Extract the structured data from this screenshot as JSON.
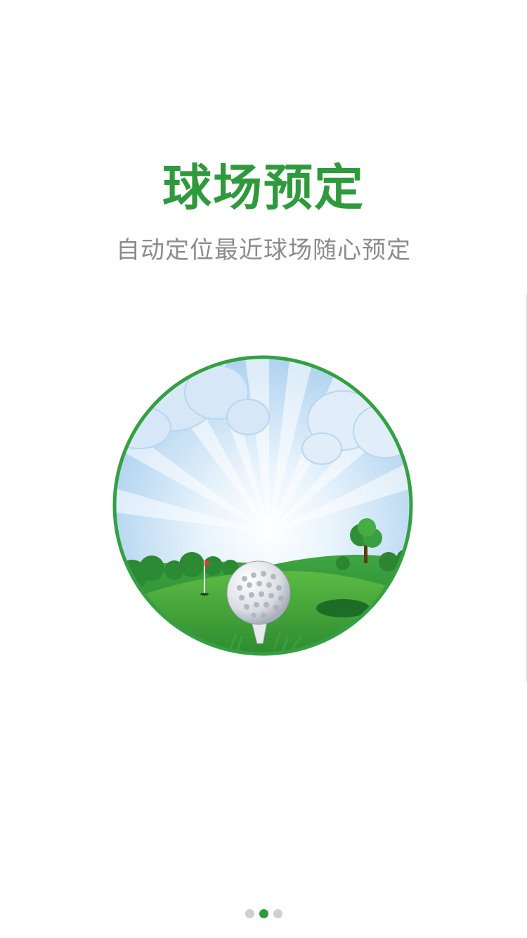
{
  "guide": {
    "title": "球场预定",
    "subtitle": "自动定位最近球场随心预定"
  },
  "illustration": {
    "icon": "golf-course-illustration",
    "frame_color": "#34a043"
  },
  "pager": {
    "total": 3,
    "active_index": 1,
    "active_color": "#2f9a3d",
    "inactive_color": "#cfcfcf"
  }
}
